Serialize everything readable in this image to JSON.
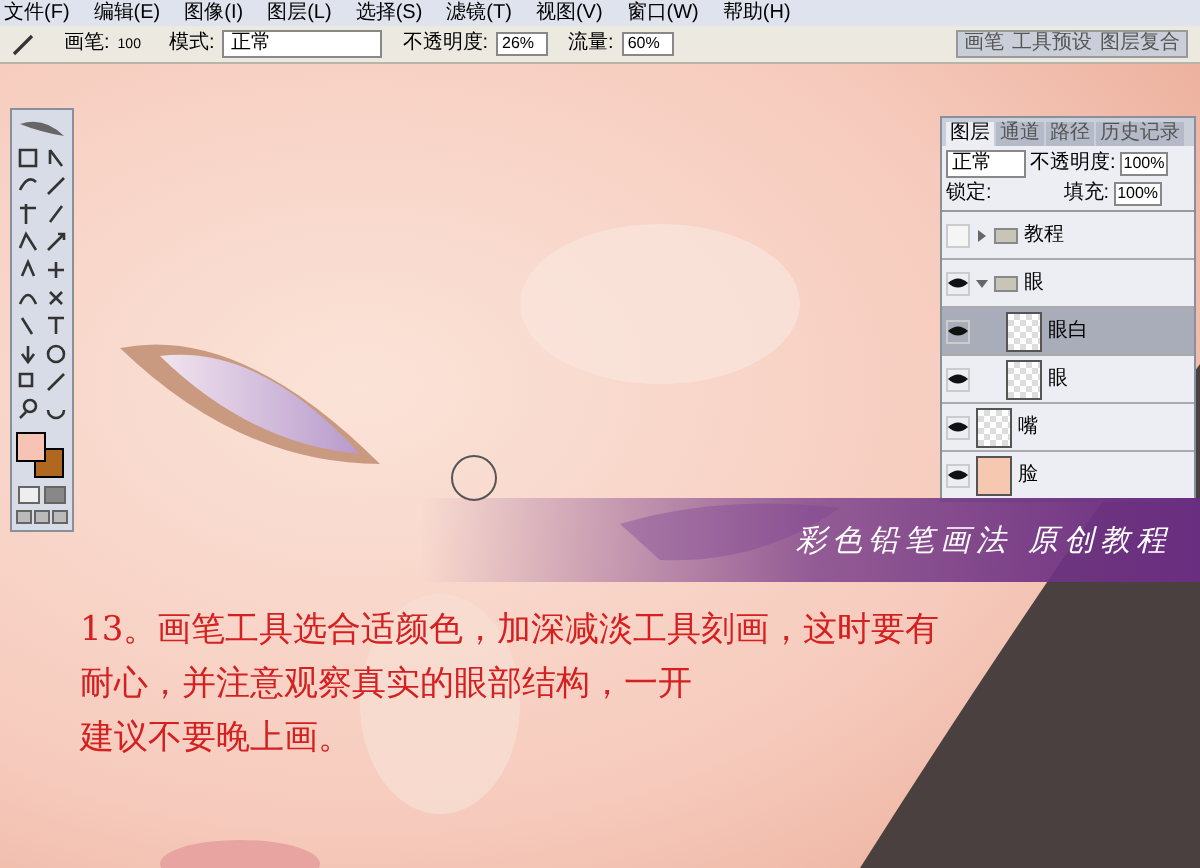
{
  "menu": [
    "文件(F)",
    "编辑(E)",
    "图像(I)",
    "图层(L)",
    "选择(S)",
    "滤镜(T)",
    "视图(V)",
    "窗口(W)",
    "帮助(H)"
  ],
  "options": {
    "brush_label": "画笔:",
    "brush_size": "100",
    "mode_label": "模式:",
    "mode": "正常",
    "opacity_label": "不透明度:",
    "opacity": "26%",
    "flow_label": "流量:",
    "flow": "60%"
  },
  "palette_well": [
    "画笔",
    "工具预设",
    "图层复合"
  ],
  "toolbox": {
    "swatches": [
      {
        "color": "#f7c3b5"
      },
      {
        "color": "#b0671f"
      }
    ]
  },
  "layers_panel": {
    "tabs": [
      {
        "label": "图层",
        "selected": true
      },
      {
        "label": "通道",
        "selected": false
      },
      {
        "label": "路径",
        "selected": false
      },
      {
        "label": "历史记录",
        "selected": false
      }
    ],
    "blend_mode": "正常",
    "opacity_label": "不透明度:",
    "opacity": "100%",
    "lock_label": "锁定:",
    "fill_label": "填充:",
    "fill": "100%",
    "layers": [
      {
        "kind": "group",
        "name": "教程",
        "visible": false,
        "expanded": false,
        "selected": false
      },
      {
        "kind": "group",
        "name": "眼",
        "visible": true,
        "expanded": true,
        "selected": false,
        "children": [
          {
            "kind": "layer",
            "name": "眼白",
            "visible": true,
            "selected": true
          },
          {
            "kind": "layer",
            "name": "眼",
            "visible": true,
            "selected": false
          }
        ]
      },
      {
        "kind": "layer",
        "name": "嘴",
        "visible": true,
        "selected": false
      },
      {
        "kind": "layer",
        "name": "脸",
        "visible": true,
        "selected": false,
        "skin": true
      }
    ]
  },
  "banner": "彩色铅笔画法 原创教程",
  "tutorial_lines": [
    "13。画笔工具选合适颜色，加深减淡工具刻画，这时要有",
    "耐心，并注意观察真实的眼部结构，一开",
    "建议不要晚上画。"
  ]
}
